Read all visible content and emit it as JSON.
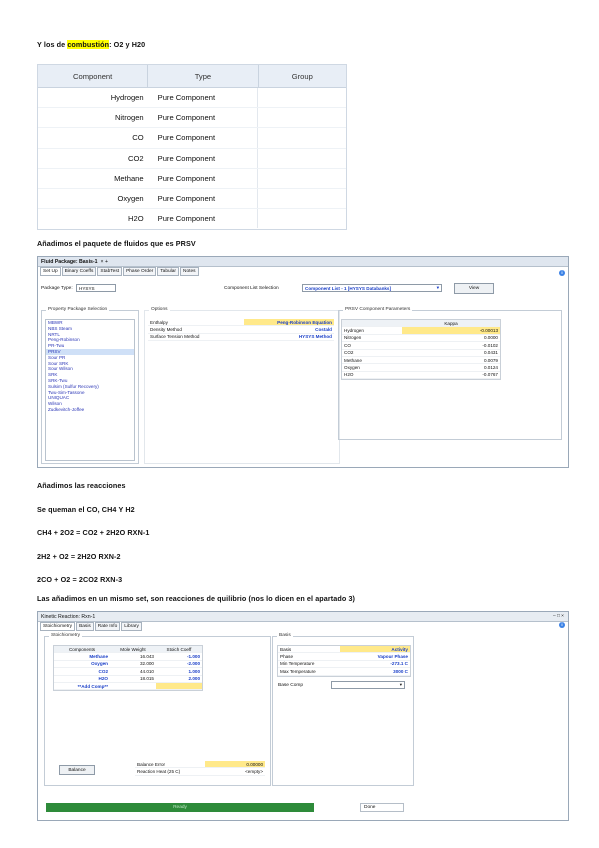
{
  "intro": {
    "prefix": "Y los de ",
    "highlight": "combustión",
    "suffix": ": O2 y H20"
  },
  "component_table": {
    "headers": [
      "Component",
      "Type",
      "Group"
    ],
    "rows": [
      {
        "component": "Hydrogen",
        "type": "Pure Component"
      },
      {
        "component": "Nitrogen",
        "type": "Pure Component"
      },
      {
        "component": "CO",
        "type": "Pure Component"
      },
      {
        "component": "CO2",
        "type": "Pure Component"
      },
      {
        "component": "Methane",
        "type": "Pure Component"
      },
      {
        "component": "Oxygen",
        "type": "Pure Component"
      },
      {
        "component": "H2O",
        "type": "Pure Component"
      }
    ]
  },
  "para2": "Añadimos el paquete de fluidos que es PRSV",
  "fluid_pkg": {
    "title": "Fluid Package: Basis-1",
    "tabs": [
      "Set Up",
      "Binary Coeffs",
      "StabTest",
      "Phase Order",
      "Tabular",
      "Notes"
    ],
    "package_type_label": "Package Type:",
    "package_type_value": "HYSYS",
    "component_list_label": "Component List Selection",
    "component_list_value": "Component List - 1 [HYSYS Databanks]",
    "view_button": "View",
    "property_package_label": "Property Package Selection",
    "property_packages": [
      "MBWR",
      "NBS Steam",
      "NRTL",
      "Peng-Robinson",
      "PR-Twu",
      "PRSV",
      "Sour PR",
      "Sour SRK",
      "Sour Wilson",
      "SRK",
      "SRK-Twu",
      "Sulsim (Sulfur Recovery)",
      "Twu-Sim-Tassone",
      "UNIQUAC",
      "Wilson",
      "Zudkevitch-Joffee"
    ],
    "selected_package": "PRSV",
    "options_label": "Options",
    "options": [
      {
        "name": "Enthalpy",
        "value": "Peng-Robinson Equation"
      },
      {
        "name": "Density Method",
        "value": "Costald"
      },
      {
        "name": "Surface Tension Method",
        "value": "HYSYS Method"
      }
    ],
    "params_label": "PRSV Component Parameters",
    "params_header": "Kappa",
    "params": [
      {
        "name": "Hydrogen",
        "value": "-0.00013"
      },
      {
        "name": "Nitrogen",
        "value": "0.0000"
      },
      {
        "name": "CO",
        "value": "-0.0102"
      },
      {
        "name": "CO2",
        "value": "0.0431"
      },
      {
        "name": "Methane",
        "value": "0.0079"
      },
      {
        "name": "Oxygen",
        "value": "0.0124"
      },
      {
        "name": "H2O",
        "value": "-0.0767"
      }
    ]
  },
  "para3": "Añadimos las reacciones",
  "para4": "Se queman el CO, CH4 Y H2",
  "rxns": [
    "CH4 + 2O2 = CO2 + 2H2O RXN-1",
    "2H2 + O2 = 2H2O RXN-2",
    "2CO + O2 = 2CO2 RXN-3"
  ],
  "para5": "Las añadimos en un mismo set, son reacciones de quilibrio (nos lo dicen en el apartado 3)",
  "reaction_win": {
    "title": "Kinetic Reaction: Rxn-1",
    "tabs": [
      "Stoichiometry",
      "Basis",
      "Rate Info",
      "Library"
    ],
    "stoich_label": "Stoichiometry",
    "col_headers": [
      "Components",
      "Mole Weight",
      "Stoich Coeff"
    ],
    "rows": [
      {
        "component": "Methane",
        "mw": "16.043",
        "coeff": "-1.000"
      },
      {
        "component": "Oxygen",
        "mw": "32.000",
        "coeff": "-2.000"
      },
      {
        "component": "CO2",
        "mw": "44.010",
        "coeff": "1.000"
      },
      {
        "component": "H2O",
        "mw": "18.015",
        "coeff": "2.000"
      }
    ],
    "add_comp": "**Add Comp**",
    "balance_btn": "Balance",
    "balance_error_label": "Balance Error",
    "balance_error_value": "0.00000",
    "heat_label": "Reaction Heat (25 C)",
    "heat_value": "<empty>",
    "basis_label": "Basis",
    "basis_rows": [
      {
        "name": "Basis",
        "value": "Activity"
      },
      {
        "name": "Phase",
        "value": "Vapour Phase"
      },
      {
        "name": "Min Temperature",
        "value": "-273.1 C"
      },
      {
        "name": "Max Temperature",
        "value": "3000 C"
      }
    ],
    "base_comp_label": "Base Comp",
    "status": "Ready",
    "status_right": "Done"
  }
}
